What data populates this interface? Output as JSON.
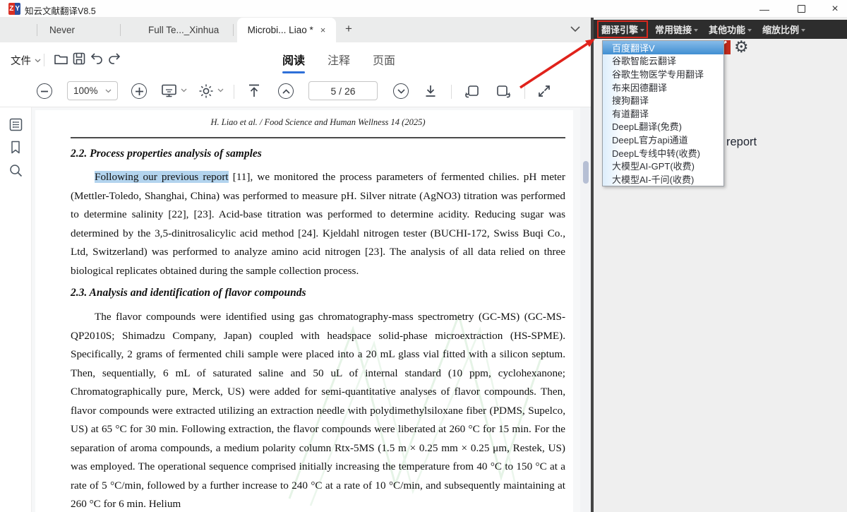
{
  "window": {
    "title": "知云文献翻译V8.5",
    "logo": {
      "left": "Z",
      "right": "Y"
    },
    "controls": {
      "minimize": "—",
      "close": "×"
    }
  },
  "tabs": {
    "items": [
      {
        "label": "Never"
      },
      {
        "label": "Full Te..._Xinhua"
      },
      {
        "label": "Microbi... Liao *",
        "active": true
      }
    ],
    "close_glyph": "×",
    "new_tab_glyph": "+"
  },
  "menubar": {
    "file_label": "文件"
  },
  "view_tabs": [
    {
      "label": "阅读",
      "active": true
    },
    {
      "label": "注释",
      "active": false
    },
    {
      "label": "页面",
      "active": false
    }
  ],
  "toolbar": {
    "zoom_value": "100%",
    "page_display": "5 / 26"
  },
  "pdf": {
    "running_header": "H. Liao et al. / Food Science and Human Wellness 14 (2025)",
    "section_2_2": "2.2. Process properties analysis of samples",
    "para1_highlight": "Following our previous report",
    "para1_rest": " [11], we monitored the process parameters of fermented chilies. pH meter (Mettler-Toledo, Shanghai, China) was performed to measure pH. Silver nitrate (AgNO3) titration was performed to determine salinity [22], [23]. Acid-base titration was performed to determine acidity. Reducing sugar was determined by the 3,5-dinitrosalicylic acid method [24]. Kjeldahl nitrogen tester (BUCHI-172, Swiss Buqi Co., Ltd, Switzerland) was performed to analyze amino acid nitrogen [23]. The analysis of all data relied on three biological replicates obtained during the sample collection process.",
    "section_2_3": "2.3. Analysis and identification of flavor compounds",
    "para2": "The flavor compounds were identified using gas chromatography-mass spectrometry (GC-MS) (GC-MS-QP2010S; Shimadzu Company, Japan) coupled with headspace solid-phase microextraction (HS-SPME). Specifically, 2 grams of fermented chili sample were placed into a 20 mL glass vial fitted with a silicon septum. Then, sequentially, 6 mL of saturated saline and 50 uL of internal standard (10 ppm, cyclohexanone; Chromatographically pure, Merck, US) were added for semi-quantitative analyses of flavor compounds. Then, flavor compounds were extracted utilizing an extraction needle with polydimethylsiloxane fiber (PDMS, Supelco, US) at 65 °C for 30 min. Following extraction, the flavor compounds were liberated at 260 °C for 15 min. For the separation of aroma compounds, a medium polarity column Rtx-5MS (1.5 m × 0.25 mm × 0.25 μm, Restek, US) was employed. The operational sequence comprised initially increasing the temperature from 40 °C to 150 °C at a rate of 5 °C/min, followed by a further increase to 240 °C at a rate of 10 °C/min, and subsequently maintaining at 260 °C for 6 min. Helium"
  },
  "right_panel": {
    "menu": [
      {
        "label": "翻译引擎",
        "boxed": true
      },
      {
        "label": "常用链接"
      },
      {
        "label": "其他功能"
      },
      {
        "label": "缩放比例"
      }
    ],
    "dropdown": {
      "items": [
        {
          "label": "百度翻译V",
          "selected": true
        },
        {
          "label": "谷歌智能云翻译"
        },
        {
          "label": "谷歌生物医学专用翻译"
        },
        {
          "label": "布来因德翻译"
        },
        {
          "label": "搜狗翻译"
        },
        {
          "label": "有道翻译"
        },
        {
          "label": "DeepL翻译(免费)"
        },
        {
          "label": "DeepL官方api通道"
        },
        {
          "label": "DeepL专线中转(收费)"
        },
        {
          "label": "大模型AI-GPT(收费)"
        },
        {
          "label": "大模型AI-千问(收费)"
        }
      ]
    },
    "partial_text": "report"
  },
  "icons": {
    "gear": "⚙"
  },
  "colors": {
    "accent_blue": "#2e6fd8",
    "selection_blue": "#b3d4ee",
    "annotation_red": "#d6281e",
    "menubar_dark": "#2d2d2d",
    "dropdown_selected": "#418fd2"
  }
}
